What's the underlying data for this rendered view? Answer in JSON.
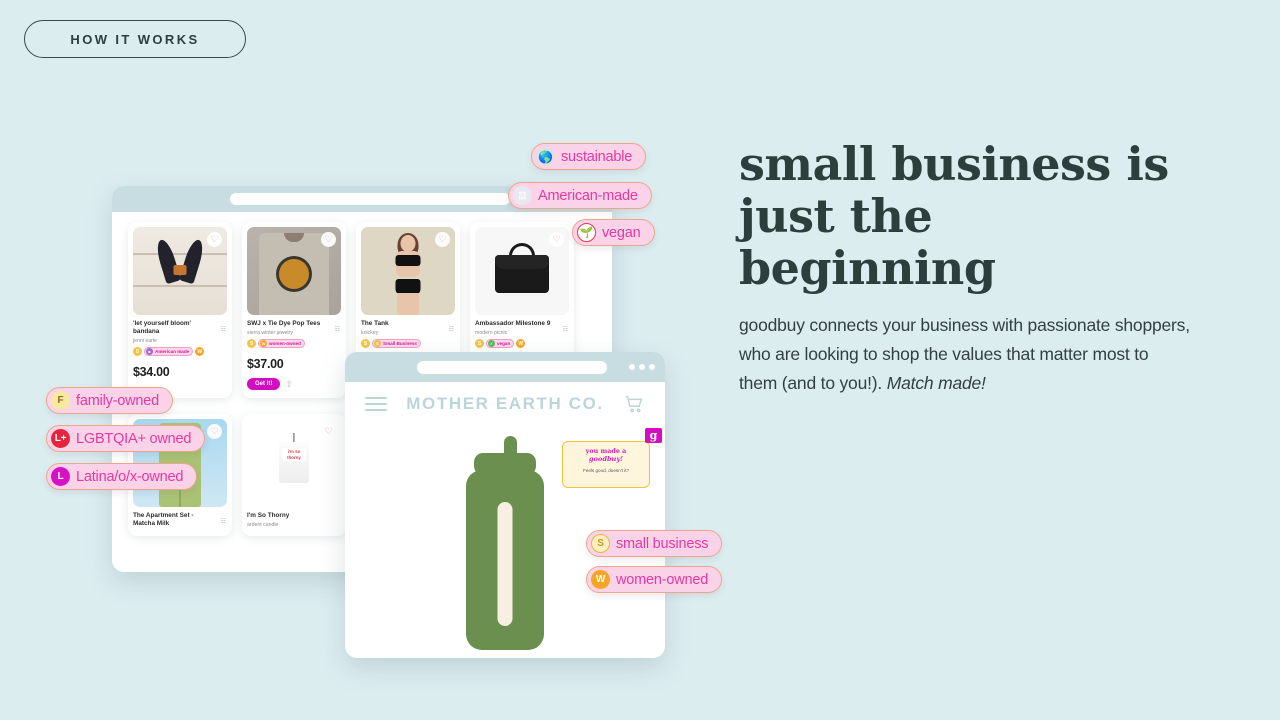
{
  "eyebrow": {
    "label": "HOW IT WORKS"
  },
  "copy": {
    "headline_line1": "small business is",
    "headline_line2": "just the beginning",
    "body_part1": "goodbuy connects your business with passionate shoppers, who are looking to shop the values that matter most to them (and to you!).",
    "body_emphasis": "Match made!"
  },
  "browser_one": {
    "products": [
      {
        "name": "'let yourself bloom' bandana",
        "shop": "jenni earle",
        "price": "$34.00",
        "badges": [
          "S",
          "American made",
          "W"
        ],
        "heart_icon": "heart-icon",
        "bookmark_icon": "bookmark-icon"
      },
      {
        "name": "SWJ x Tie Dye Pop Tees",
        "shop": "sierra winter jewelry",
        "price": "$37.00",
        "badges": [
          "S",
          "women-owned"
        ],
        "cta": "Get it!",
        "heart_icon": "heart-icon",
        "bookmark_icon": "bookmark-icon",
        "share_icon": "share-icon"
      },
      {
        "name": "The Tank",
        "shop": "knickey",
        "price": "",
        "badges": [
          "S",
          "Small Business"
        ],
        "heart_icon": "heart-icon",
        "bookmark_icon": "bookmark-icon"
      },
      {
        "name": "Ambassador Milestone 9",
        "shop": "modern picnic",
        "price": "",
        "badges": [
          "S",
          "vegan",
          "W"
        ],
        "heart_icon": "heart-icon",
        "bookmark_icon": "bookmark-icon"
      },
      {
        "name": "The Apartment Set - Matcha Milk",
        "shop": "",
        "price": "",
        "badges": [],
        "heart_icon": "heart-icon",
        "bookmark_icon": "bookmark-icon"
      },
      {
        "name": "I'm So Thorny",
        "shop": "ardent candle",
        "price": "",
        "badges": [],
        "heart_icon": "heart-icon",
        "bookmark_icon": "bookmark-icon"
      }
    ],
    "candle_label_line1": "i'm so",
    "candle_label_line2": "thorny"
  },
  "browser_two": {
    "store_name": "MOTHER EARTH CO.",
    "menu_icon": "hamburger-menu-icon",
    "cart_icon": "shopping-cart-icon",
    "product_image_alt": "green-water-bottle"
  },
  "tooltip": {
    "line1": "you made a",
    "line2": "goodbuy!",
    "subtext": "Feels good, doesn't it?",
    "badge_letter": "g"
  },
  "value_pills": [
    {
      "label": "sustainable",
      "badge": "🌎",
      "badge_color": "#e0e0e0",
      "icon_name": "globe-icon"
    },
    {
      "label": "American-made",
      "badge": "🇺🇸",
      "badge_color": "#e8e8f0",
      "icon_name": "flag-icon"
    },
    {
      "label": "vegan",
      "badge": "🌱",
      "badge_color": "#ffffff",
      "icon_name": "sprout-icon"
    },
    {
      "label": "family-owned",
      "badge": "F",
      "badge_color": "#f7e9a0",
      "icon_name": "family-badge-icon"
    },
    {
      "label": "LGBTQIA+ owned",
      "badge": "L+",
      "badge_color": "#e8243c",
      "icon_name": "lgbtqia-badge-icon"
    },
    {
      "label": "Latina/o/x-owned",
      "badge": "L",
      "badge_color": "#d712c6",
      "icon_name": "latinx-badge-icon"
    },
    {
      "label": "small business",
      "badge": "S",
      "badge_color": "#fbeec2",
      "icon_name": "small-business-badge-icon"
    },
    {
      "label": "women-owned",
      "badge": "W",
      "badge_color": "#f5a623",
      "icon_name": "women-owned-badge-icon"
    }
  ],
  "colors": {
    "page_bg": "#dcedf0",
    "heading": "#2d3f3c",
    "pill_bg": "#fbd3e9",
    "pill_border": "#f0a58b",
    "pill_text": "#e4399f",
    "accent_magenta": "#d40ec0",
    "chrome": "#c7dde1",
    "bottle_green": "#6b8f4e"
  }
}
